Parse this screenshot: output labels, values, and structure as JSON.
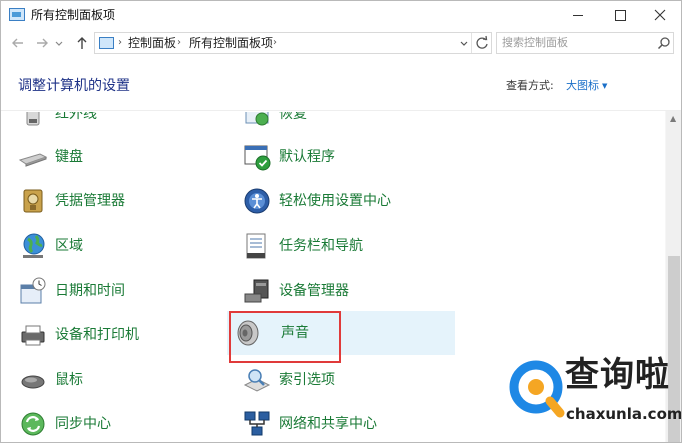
{
  "window": {
    "title": "所有控制面板项"
  },
  "nav": {
    "crumbs": [
      "控制面板",
      "所有控制面板项"
    ],
    "search_placeholder": "搜索控制面板"
  },
  "header": {
    "title": "调整计算机的设置",
    "view_by_label": "查看方式:",
    "view_by_value": "大图标"
  },
  "left_items": [
    {
      "label": "红外线",
      "icon": "infrared-icon"
    },
    {
      "label": "键盘",
      "icon": "keyboard-icon"
    },
    {
      "label": "凭据管理器",
      "icon": "credential-manager-icon"
    },
    {
      "label": "区域",
      "icon": "region-globe-icon"
    },
    {
      "label": "日期和时间",
      "icon": "date-time-icon"
    },
    {
      "label": "设备和打印机",
      "icon": "printer-icon"
    },
    {
      "label": "鼠标",
      "icon": "mouse-icon"
    },
    {
      "label": "同步中心",
      "icon": "sync-center-icon"
    }
  ],
  "right_items": [
    {
      "label": "恢复",
      "icon": "recovery-icon"
    },
    {
      "label": "默认程序",
      "icon": "default-programs-icon"
    },
    {
      "label": "轻松使用设置中心",
      "icon": "ease-of-access-icon"
    },
    {
      "label": "任务栏和导航",
      "icon": "taskbar-navigation-icon"
    },
    {
      "label": "设备管理器",
      "icon": "device-manager-icon"
    },
    {
      "label": "声音",
      "icon": "sound-speaker-icon",
      "highlighted": true
    },
    {
      "label": "索引选项",
      "icon": "indexing-options-icon"
    },
    {
      "label": "网络和共享中心",
      "icon": "network-sharing-icon"
    }
  ],
  "watermark": {
    "text": "查询啦",
    "site": "chaxunla.com"
  },
  "colors": {
    "link_green": "#1a7a36",
    "title_blue": "#1e3287",
    "highlight_bg": "#e5f3fb",
    "annotation_red": "#e03a3a"
  }
}
